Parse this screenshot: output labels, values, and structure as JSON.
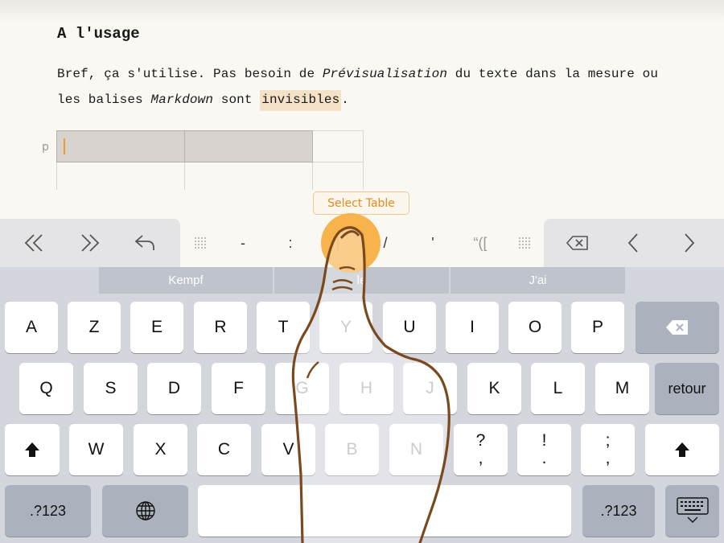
{
  "document": {
    "heading": "A l'usage",
    "line1_a": "Bref, ça s'utilise. Pas besoin de ",
    "line1_em": "Prévisualisation",
    "line1_b": " du texte dans la mesure ou",
    "line2_a": "les balises ",
    "line2_em": "Markdown",
    "line2_b": " sont ",
    "line2_hl": "invisibles",
    "line2_end": ".",
    "paragraph_marker": "p",
    "select_table_label": "Select Table"
  },
  "toolbar": {
    "keys": [
      "-",
      ":",
      "|",
      "/",
      "'",
      "“(["
    ]
  },
  "suggestions": [
    "Kempf",
    "le",
    "J'ai"
  ],
  "keyboard": {
    "row1": [
      "A",
      "Z",
      "E",
      "R",
      "T",
      "Y",
      "U",
      "I",
      "O",
      "P"
    ],
    "row2": [
      "Q",
      "S",
      "D",
      "F",
      "G",
      "H",
      "J",
      "K",
      "L",
      "M"
    ],
    "row2_return": "retour",
    "row3": [
      "W",
      "X",
      "C",
      "V",
      "B",
      "N"
    ],
    "row3_punct1": [
      "?",
      ","
    ],
    "row3_punct2": [
      "!",
      "."
    ],
    "row3_punct3": [
      ";",
      ","
    ],
    "num_label": ".?123"
  },
  "colors": {
    "accent": "#e8a034",
    "highlight": "#f5e2c6",
    "hand_stroke": "#7a4a1e"
  }
}
